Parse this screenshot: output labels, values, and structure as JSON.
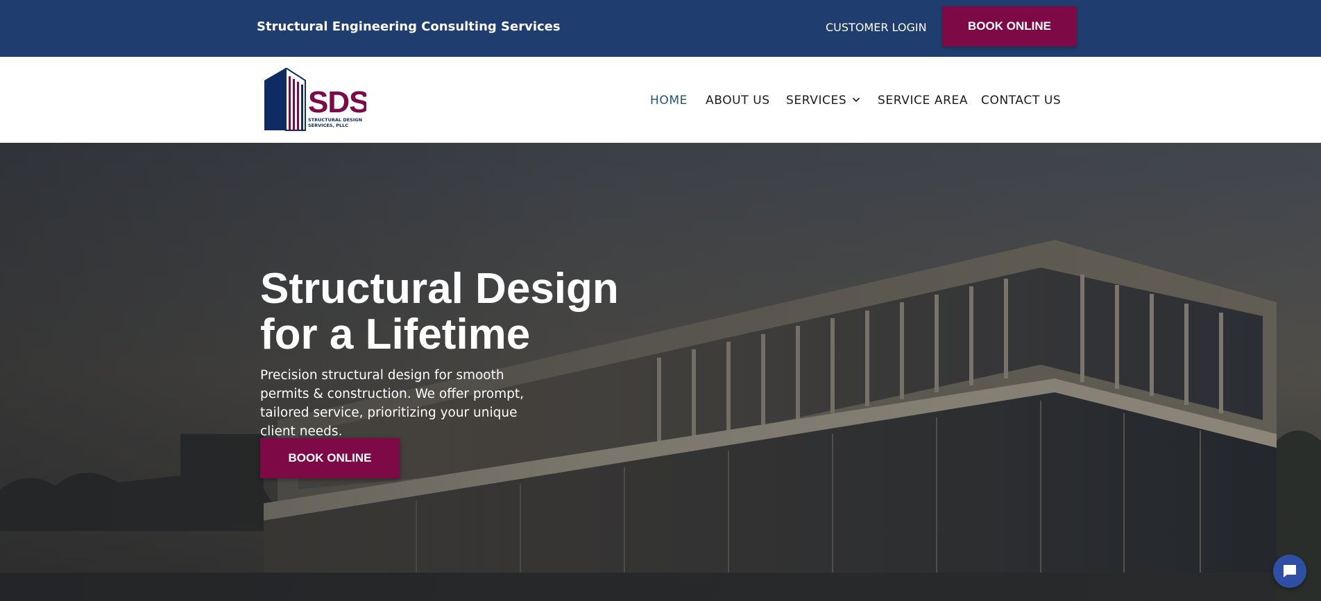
{
  "topbar": {
    "tagline": "Structural Engineering Consulting Services",
    "login_label": "CUSTOMER LOGIN",
    "book_label": "BOOK ONLINE"
  },
  "header": {
    "logo": {
      "text": "SDS",
      "subtext_line1": "STRUCTURAL DESIGN",
      "subtext_line2": "SERVICES, PLLC"
    },
    "nav": {
      "home": "HOME",
      "about": "ABOUT US",
      "services": "SERVICES",
      "service_area": "SERVICE AREA",
      "contact": "CONTACT US"
    }
  },
  "hero": {
    "title_line1": "Structural Design",
    "title_line2": "for a Lifetime",
    "description": "Precision structural design for smooth permits & construction. We offer prompt, tailored service, prioritizing your unique client needs.",
    "book_label": "BOOK ONLINE"
  },
  "colors": {
    "topbar": "#1f3d6e",
    "accent": "#7d0a47",
    "nav_active": "#24507a",
    "logo_blue": "#0f2b63",
    "chat": "#2e4fa3"
  },
  "icons": {
    "services_dropdown": "chevron-down-icon",
    "chat": "chat-bubble-icon"
  }
}
